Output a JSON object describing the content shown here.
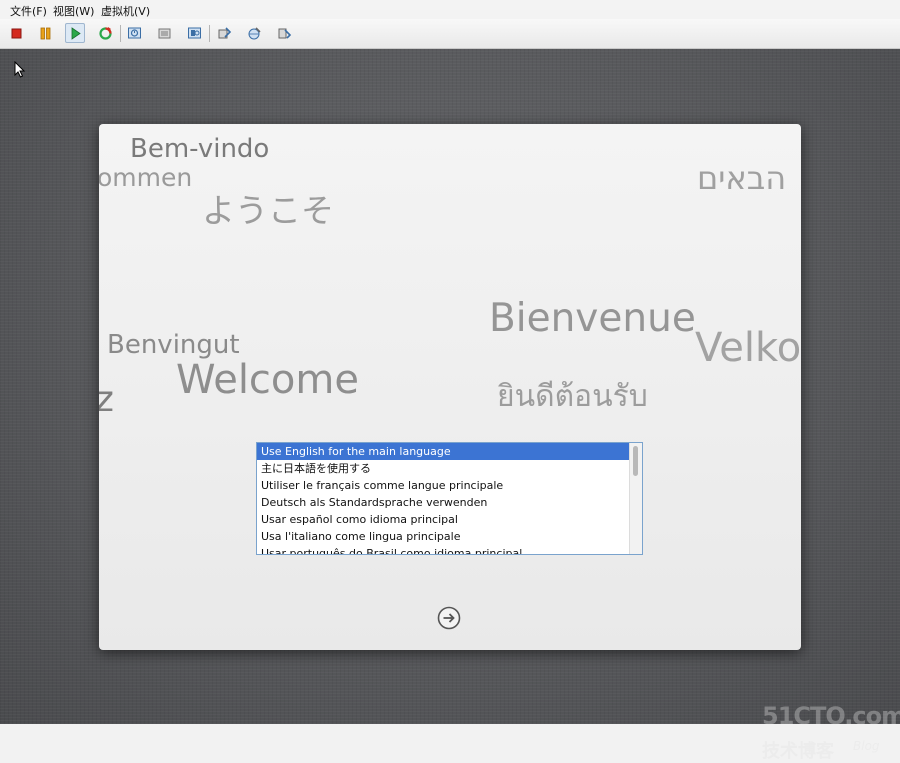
{
  "menu": {
    "file": "文件(F)",
    "view": "视图(W)",
    "vm": "虚拟机(V)"
  },
  "toolbar": {
    "icons": [
      "stop-icon",
      "pause-icon",
      "play-icon",
      "reset-icon",
      "snapshot-icon",
      "snapshot-restore-icon",
      "snapshot-manager-icon",
      "settings-icon",
      "network-icon",
      "usb-icon"
    ],
    "colors": {
      "stop": "#d42a1f",
      "pause": "#e8a21a",
      "play": "#2aa84a"
    }
  },
  "welcome_words": {
    "bem_vindo": "Bem-vindo",
    "ommen": "ommen",
    "youkoso": "ようこそ",
    "hebrew": "הבאים",
    "bienvenue": "Bienvenue",
    "benvingut": "Benvingut",
    "velko": "Velko",
    "welcome": "Welcome",
    "z": "z",
    "thai": "ยินดีต้อนรับ"
  },
  "language_list": {
    "items": [
      "Use English for the main language",
      "主に日本語を使用する",
      "Utiliser le français comme langue principale",
      "Deutsch als Standardsprache verwenden",
      "Usar español como idioma principal",
      "Usa l'italiano come lingua principale",
      "Usar português do Brasil como idioma principal"
    ],
    "selected_index": 0,
    "selection_color": "#3c74d3"
  },
  "next_button": {
    "icon": "arrow-right-circle-icon"
  },
  "watermark": {
    "site": "51CTO.com",
    "cn": "技术博客",
    "blog": "Blog"
  }
}
